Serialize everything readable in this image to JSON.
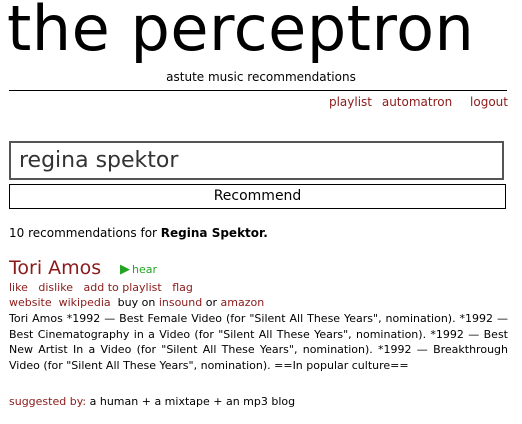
{
  "header": {
    "title": "the perceptron",
    "tagline": "astute music recommendations"
  },
  "nav": {
    "playlist": "playlist",
    "automatron": "automatron",
    "logout": "logout"
  },
  "search": {
    "value": "regina spektor",
    "button_label": "Recommend"
  },
  "results": {
    "count_text": "10 recommendations for",
    "query_artist": "Regina Spektor."
  },
  "recommendation": {
    "artist": "Tori Amos",
    "hear_label": "hear",
    "actions": {
      "like": "like",
      "dislike": "dislike",
      "add_to_playlist": "add to playlist",
      "flag": "flag"
    },
    "links": {
      "website": "website",
      "wikipedia": "wikipedia",
      "buy_on": "buy on",
      "insound": "insound",
      "or": "or",
      "amazon": "amazon"
    },
    "description": "Tori Amos *1992 — Best Female Video (for \"Silent All These Years\", nomination). *1992 — Best Cinematography in a Video (for \"Silent All These Years\", nomination). *1992 — Best New Artist In a Video (for \"Silent All These Years\", nomination). *1992 — Breakthrough Video (for \"Silent All These Years\", nomination). ==In popular culture==",
    "suggested_label": "suggested by:",
    "suggested_value": "a human + a mixtape + an mp3 blog"
  },
  "colors": {
    "link": "#8b1a1a",
    "hear": "#22a422"
  },
  "icons": {
    "play": "play-icon"
  }
}
